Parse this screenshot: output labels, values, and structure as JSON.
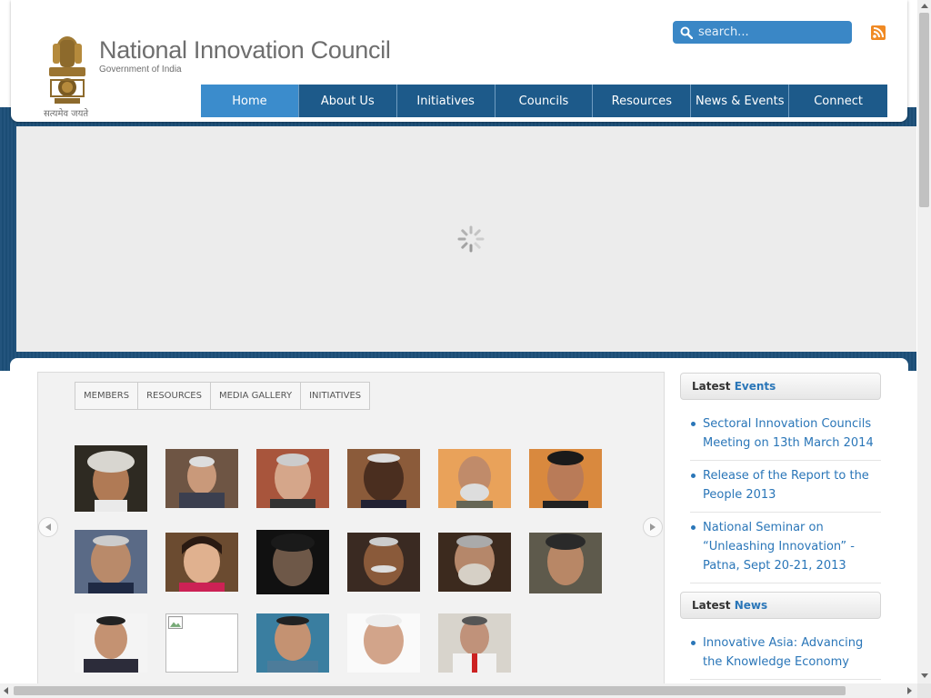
{
  "header": {
    "title": "National Innovation Council",
    "subtitle": "Government of India",
    "emblem_motto": "सत्यमेव जयते",
    "search_placeholder": "search...",
    "rss_icon": "rss-icon"
  },
  "nav": {
    "items": [
      {
        "label": "Home",
        "active": true
      },
      {
        "label": "About Us"
      },
      {
        "label": "Initiatives"
      },
      {
        "label": "Councils"
      },
      {
        "label": "Resources"
      },
      {
        "label": "News & Events"
      },
      {
        "label": "Connect"
      }
    ]
  },
  "slider": {
    "state": "loading"
  },
  "tabs": [
    "MEMBERS",
    "RESOURCES",
    "MEDIA GALLERY",
    "INITIATIVES"
  ],
  "members_gallery": {
    "rows": 3,
    "photos_per_row": [
      6,
      6,
      5
    ],
    "broken_image_index": 13
  },
  "sidebar": {
    "events_heading_prefix": "Latest",
    "events_heading_highlight": "Events",
    "events": [
      "Sectoral Innovation Councils Meeting on 13th March 2014",
      "Release of the Report to the People 2013",
      "National Seminar on “Unleashing Innovation” - Patna, Sept 20-21, 2013"
    ],
    "news_heading_prefix": "Latest",
    "news_heading_highlight": "News",
    "news": [
      "Innovative Asia: Advancing the Knowledge Economy"
    ]
  },
  "colors": {
    "brand_blue": "#1d5a8a",
    "active_nav": "#3b8ccc",
    "link_blue": "#2a76b8",
    "band": "#1c4f79"
  }
}
